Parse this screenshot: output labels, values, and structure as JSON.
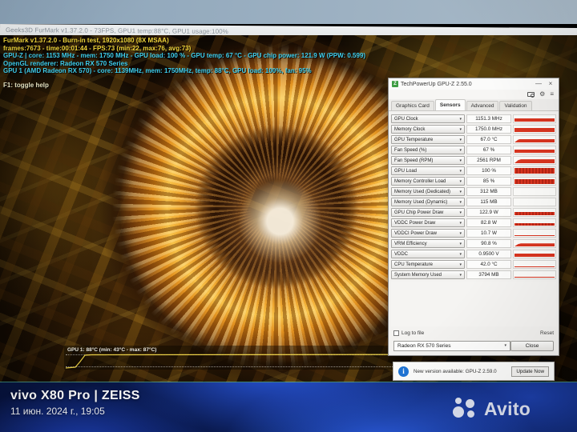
{
  "furmark": {
    "window_title": "Geeks3D FurMark v1.37.2.0 - 73FPS, GPU1 temp:88°C, GPU1 usage:100%",
    "osd_lines": [
      {
        "text": "FurMark v1.37.2.0 - Burn-in test, 1920x1080 (8X MSAA)",
        "color": "#f2d63c"
      },
      {
        "text": "frames:7673 - time:00:01:44 - FPS:73 (min:22, max:76, avg:73)",
        "color": "#f2d63c"
      },
      {
        "text": "GPU-Z | core: 1153 MHz - mem: 1750 MHz - GPU load: 100 % - GPU temp: 67 °C - GPU chip power: 121.9 W (PPW: 0.599)",
        "color": "#3fd0f0"
      },
      {
        "text": "OpenGL renderer: Radeon RX 570 Series",
        "color": "#3fd0f0"
      },
      {
        "text": "GPU 1 (AMD Radeon RX 570) - core: 1139MHz, mem: 1750MHz, temp: 88°C, GPU load: 100%, fan: 95%",
        "color": "#3fd0f0"
      }
    ],
    "help_line": "F1: toggle help",
    "help_color": "#e9e6c4",
    "temp_graph_label": "GPU 1: 88°C (min: 43°C - max: 87°C)"
  },
  "gpuz": {
    "title": "TechPowerUp GPU-Z 2.55.0",
    "app_icon_letter": "Z",
    "minimize_glyph": "—",
    "close_glyph": "×",
    "tabs": [
      "Graphics Card",
      "Sensors",
      "Advanced",
      "Validation"
    ],
    "active_tab": "Sensors",
    "sensors": [
      {
        "label": "GPU Clock",
        "value": "1151.3 MHz",
        "bar": {
          "h": 0.5,
          "profile": "flat"
        }
      },
      {
        "label": "Memory Clock",
        "value": "1750.0 MHz",
        "bar": {
          "h": 0.55,
          "profile": "flat"
        }
      },
      {
        "label": "GPU Temperature",
        "value": "67.0 °C",
        "bar": {
          "h": 0.5,
          "profile": "ramp"
        }
      },
      {
        "label": "Fan Speed (%)",
        "value": "67 %",
        "bar": {
          "h": 0.5,
          "profile": "flat"
        }
      },
      {
        "label": "Fan Speed (RPM)",
        "value": "2561 RPM",
        "bar": {
          "h": 0.55,
          "profile": "ramp"
        }
      },
      {
        "label": "GPU Load",
        "value": "100 %",
        "bar": {
          "h": 0.8,
          "profile": "jagged"
        }
      },
      {
        "label": "Memory Controller Load",
        "value": "85 %",
        "bar": {
          "h": 0.65,
          "profile": "jagged"
        }
      },
      {
        "label": "Memory Used (Dedicated)",
        "value": "312 MB",
        "bar": {
          "h": 0.0,
          "profile": "none"
        }
      },
      {
        "label": "Memory Used (Dynamic)",
        "value": "115 MB",
        "bar": {
          "h": 0.0,
          "profile": "none"
        }
      },
      {
        "label": "GPU Chip Power Draw",
        "value": "122.9 W",
        "bar": {
          "h": 0.42,
          "profile": "jagged"
        }
      },
      {
        "label": "VDDC Power Draw",
        "value": "82.8 W",
        "bar": {
          "h": 0.38,
          "profile": "jagged"
        }
      },
      {
        "label": "VDDCI Power Draw",
        "value": "10.7 W",
        "bar": {
          "h": 0.14,
          "profile": "flat"
        }
      },
      {
        "label": "VRM Efficiency",
        "value": "90.8 %",
        "bar": {
          "h": 0.42,
          "profile": "ramp"
        }
      },
      {
        "label": "VDDC",
        "value": "0.9500 V",
        "bar": {
          "h": 0.5,
          "profile": "flat"
        }
      },
      {
        "label": "CPU Temperature",
        "value": "42.0 °C",
        "bar": {
          "h": 0.08,
          "profile": "flat"
        }
      },
      {
        "label": "System Memory Used",
        "value": "3794 MB",
        "bar": {
          "h": 0.16,
          "profile": "flat"
        }
      }
    ],
    "log_to_file_label": "Log to file",
    "reset_label": "Reset",
    "gpu_select_value": "Radeon RX 570 Series",
    "select_caret": "▾",
    "close_label": "Close",
    "update_bar": {
      "message": "New version available: GPU-Z 2.59.0",
      "button": "Update Now",
      "info_glyph": "i"
    }
  },
  "photo": {
    "watermark_device": "vivo X80 Pro | ZEISS",
    "watermark_datetime": "11 июн. 2024 г., 19:05",
    "watermark_site": "Avito"
  },
  "colors": {
    "bar_red": "#d8341f",
    "osd_yellow": "#f2d63c",
    "osd_cyan": "#3fd0f0",
    "wallpaper_blue": "#2a58e0"
  }
}
